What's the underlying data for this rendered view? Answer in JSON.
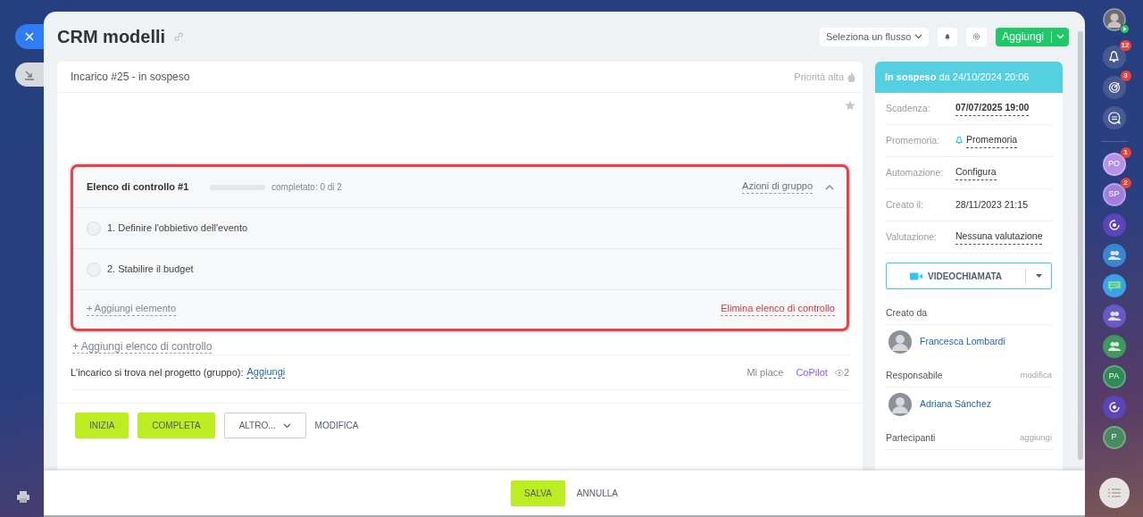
{
  "header": {
    "title": "CRM modelli",
    "flow_select": "Seleziona un flusso",
    "add_button": "Aggiungi"
  },
  "task": {
    "title": "Incarico #25 - in sospeso",
    "priority": "Priorità alta",
    "starred": false,
    "checklist": {
      "title": "Elenco di controllo #1",
      "level": 0,
      "progress_text": "completato: 0 di 2",
      "group_actions": "Azioni di gruppo",
      "expanded": true,
      "items": [
        {
          "label": "1. Definire l'obbietivo dell'evento",
          "checked": false
        },
        {
          "label": "2. Stabilire il budget",
          "checked": false
        }
      ],
      "add_item": "+ Aggiungi elemento",
      "delete": "Elimina elenco di controllo"
    },
    "add_checklist": "+ Aggiungi elenco di controllo",
    "project_label": "L'incarico si trova nel progetto (gruppo):",
    "project_link": "Aggiungi",
    "like": "Mi piace",
    "copilot": "CoPilot",
    "views": "2",
    "actions": [
      {
        "label": "INIZIA",
        "kind": "primary"
      },
      {
        "label": "COMPLETA",
        "kind": "primary"
      },
      {
        "label": "ALTRO...",
        "kind": "dropdown"
      },
      {
        "label": "MODIFICA",
        "kind": "link"
      }
    ]
  },
  "sidebar": {
    "status": "In sospeso",
    "status_since": "da 24/10/2024 20:06",
    "fields": [
      {
        "label": "Scadenza:",
        "value": "07/07/2025 19:00",
        "kind": "strong-link"
      },
      {
        "label": "Promemoria:",
        "value": "Promemoria",
        "kind": "reminder"
      },
      {
        "label": "Automazione:",
        "value": "Configura",
        "kind": "link"
      },
      {
        "label": "Creato il:",
        "value": "28/11/2023 21:15",
        "kind": "text"
      },
      {
        "label": "Valutazione:",
        "value": "Nessuna valutazione",
        "kind": "link"
      }
    ],
    "video_call": "VIDEOCHIAMATA",
    "people": [
      {
        "heading": "Creato da",
        "name": "Francesca Lombardi"
      },
      {
        "heading": "Responsabile",
        "action": "modifica",
        "name": "Adriana Sánchez"
      },
      {
        "heading": "Partecipanti",
        "action": "aggiungi"
      }
    ]
  },
  "footer": {
    "save": "SALVA",
    "cancel": "ANNULLA"
  },
  "right_rail": [
    {
      "kind": "photo"
    },
    {
      "kind": "bell",
      "badge": "12"
    },
    {
      "kind": "target",
      "badge": "3"
    },
    {
      "kind": "chat"
    },
    {
      "kind": "divider"
    },
    {
      "kind": "initials",
      "text": "PO",
      "badge": "1",
      "color": "#b592e6"
    },
    {
      "kind": "initials",
      "text": "SP",
      "badge": "2",
      "color": "#a07ee0"
    },
    {
      "kind": "swirl",
      "color": "#5b45b8"
    },
    {
      "kind": "group",
      "color": "#3b86cf"
    },
    {
      "kind": "bubble",
      "color": "#3aa3e6"
    },
    {
      "kind": "group",
      "color": "#6a58c4"
    },
    {
      "kind": "group",
      "color": "#3e9a5c"
    },
    {
      "kind": "initials",
      "text": "PA",
      "color": "#2f8a55"
    },
    {
      "kind": "swirl",
      "color": "#5b45b8"
    },
    {
      "kind": "initials",
      "text": "P",
      "color": "#4a8a60"
    }
  ]
}
